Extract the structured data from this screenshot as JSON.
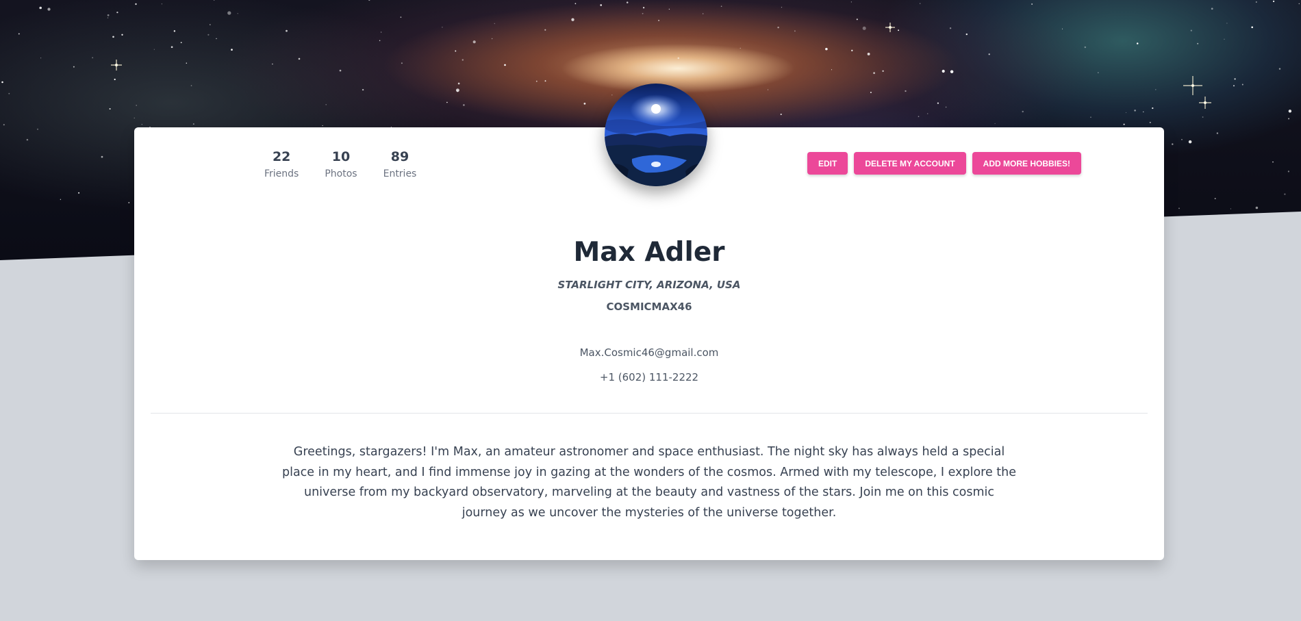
{
  "profile": {
    "name": "Max Adler",
    "location": "STARLIGHT CITY, ARIZONA, USA",
    "username": "COSMICMAX46",
    "email": "Max.Cosmic46@gmail.com",
    "phone": "+1 (602) 111-2222",
    "bio": "Greetings, stargazers! I'm Max, an amateur astronomer and space enthusiast. The night sky has always held a special place in my heart, and I find immense joy in gazing at the wonders of the cosmos. Armed with my telescope, I explore the universe from my backyard observatory, marveling at the beauty and vastness of the stars. Join me on this cosmic journey as we uncover the mysteries of the universe together."
  },
  "stats": [
    {
      "value": "22",
      "label": "Friends"
    },
    {
      "value": "10",
      "label": "Photos"
    },
    {
      "value": "89",
      "label": "Entries"
    }
  ],
  "actions": {
    "edit": "EDIT",
    "delete": "DELETE MY ACCOUNT",
    "add_hobbies": "ADD MORE HOBBIES!"
  },
  "images": {
    "banner": "galaxy-banner-image",
    "avatar": "night-sky-moon-avatar"
  },
  "colors": {
    "accent": "#ec4899",
    "page_bg": "#d1d5db",
    "card_bg": "#ffffff",
    "text_dark": "#1f2937",
    "text_muted": "#4b5563"
  }
}
